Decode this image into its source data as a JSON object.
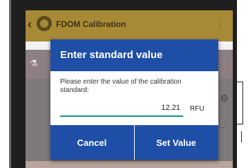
{
  "appbar": {
    "back_icon": "chevron-left-icon",
    "logo_icon": "app-logo-icon",
    "title": "FDOM Calibration",
    "more_icon": "overflow-menu-icon"
  },
  "subbar": {
    "flask_icon": "flask-icon"
  },
  "content": {
    "gear_icon": "gear-icon",
    "more_icon": "more-horizontal-icon"
  },
  "dialog": {
    "title": "Enter standard value",
    "message": "Please enter the value of the calibration standard:",
    "value": "12.21",
    "unit": "RFU",
    "cancel_label": "Cancel",
    "set_label": "Set Value"
  },
  "colors": {
    "appbar": "#a88a36",
    "dialog_header": "#1e4ea6",
    "field_underline": "#1a8c8c"
  }
}
